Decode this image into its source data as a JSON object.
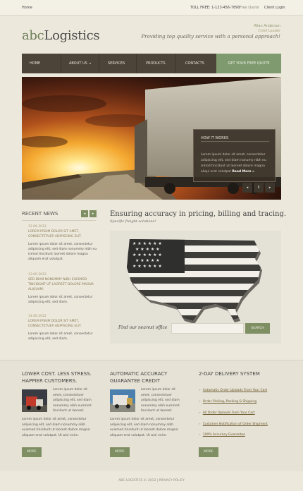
{
  "topbar": {
    "home": "Home",
    "toll": "TOLL FREE: 1-123-456-7890",
    "free_quote": "Free Quote",
    "client_login": "Client Login"
  },
  "logo": {
    "abc": "abc",
    "rest": "Logistics"
  },
  "header": {
    "author": "Allan Anderson",
    "role": "Chief Leader",
    "slogan": "Providing top quality service with a personal approach!"
  },
  "nav": {
    "items": [
      "HOME",
      "ABOUT US",
      "SERVICES",
      "PRODUCTS",
      "CONTACTS"
    ],
    "quote": "GET YOUR FREE QUOTE"
  },
  "slider": {
    "box_title": "HOW IT WORKS",
    "box_text": "Lorem ipsum dolor sit amet, consectetur adipiscing elit, sed diam nonumy nibh eu ismod tincidunt ut laoreet dolore magna aliqui erat volutpat",
    "read_more": "Read More »",
    "prev": "◂",
    "pause": "II",
    "next": "▸"
  },
  "news": {
    "title": "RECENT NEWS",
    "prev": "◂",
    "next": "▸",
    "items": [
      {
        "date": "12.06.2012",
        "head": "LOREM IPSUM DOLOR SIT AMET, CONSECTETUER ADIPISCING ELIT.",
        "body": "Lorem ipsum dolor sit amet, consectetur adipiscing elit, sed diam nonummy nibh eu ismod tincidunt laoreet dolore magna aliquam erat volutpat."
      },
      {
        "date": "13.06.2012",
        "head": "SED DIAM NONUMMY NIBH EUISMOD TINCIDUNT UT LAOREET DOLORE MAGNA ALIQUAM.",
        "body": "Lorem ipsum dolor sit amet, consectetur adipiscing elit, sed diam."
      },
      {
        "date": "14.06.2012",
        "head": "LOREM IPSUM DOLOR SIT AMET, CONSECTETUER ADIPISCING ELIT.",
        "body": "Lorem ipsum dolor sit amet, consectetur adipiscing elit, sed diam."
      }
    ]
  },
  "main": {
    "title": "Ensuring accuracy in pricing, billing and tracing.",
    "subtitle": "Specific freight solutions!",
    "find_label": "Find our nearest office",
    "search_button": "SEARCH"
  },
  "columns": [
    {
      "title": "LOWER COST. LESS STRESS. HAPPIER CUSTOMERS.",
      "side_text": "Lorem ipsum dolor sit amet, consectetuer adipiscing elit, sed diam nonummy nibh euismod tincidunt ut laoreet.",
      "text": "Lorem ipsum dolor sit amet, consectetur adipiscing elit, sed diam nonummy nibh euismod tincidunt ut laoreet dolore magna aliquam erat volutpat. Ut wisi enim.",
      "more": "MORE"
    },
    {
      "title": "AUTOMATIC ACCURACY GUARANTEE CREDIT",
      "side_text": "Lorem ipsum dolor sit amet, consectetuer adipiscing elit, sed diam nonummy nibh euismod tincidunt ut laoreet.",
      "text": "Lorem ipsum dolor sit amet, consectetur adipiscing elit, sed diam nonummy nibh euismod tincidunt ut laoreet dolore magna aliquam erat volutpat. Ut wisi enim.",
      "more": "MORE"
    },
    {
      "title": "2-DAY DELIVERY SYSTEM",
      "links": [
        "Automatic Order Uploads From Your Cart",
        "Order Picking, Packing & Shipping",
        "All Order Uploads From Your Cart",
        "Customer Notification of Order Shipment",
        "100% Accuracy Guarantee"
      ],
      "more": "MORE"
    }
  ],
  "footer": {
    "text": "ABC LOGISTICS © 2012  |  PRIVACY POLICY"
  }
}
